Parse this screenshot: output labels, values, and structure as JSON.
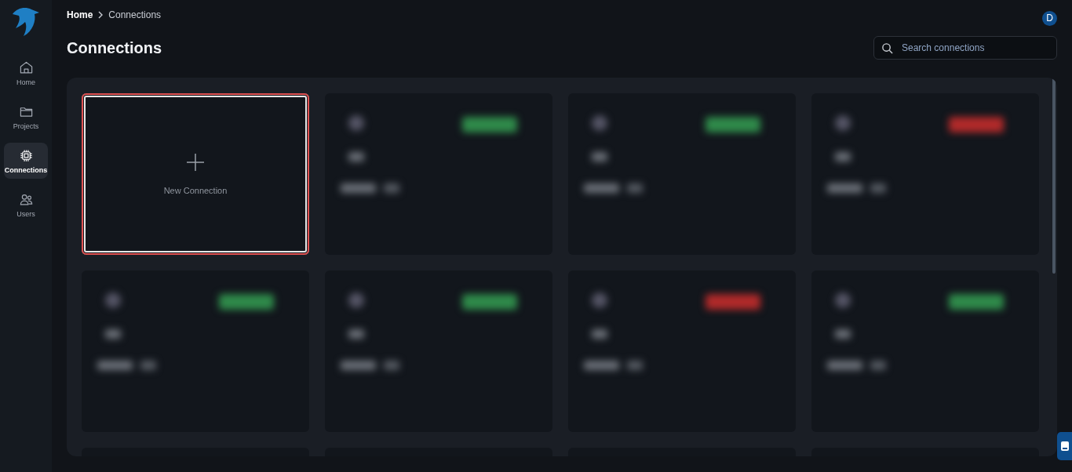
{
  "sidebar": {
    "items": [
      {
        "label": "Home",
        "selected": false
      },
      {
        "label": "Projects",
        "selected": false
      },
      {
        "label": "Connections",
        "selected": true
      },
      {
        "label": "Users",
        "selected": false
      }
    ]
  },
  "breadcrumb": [
    "Home",
    "Connections"
  ],
  "avatar": "D",
  "title": "Connections",
  "search": {
    "placeholder": "Search connections"
  },
  "cards": [
    {
      "kind": "new",
      "label": "New Connection",
      "highlighted": true
    },
    {
      "kind": "blurred",
      "color": "#2f8a4a"
    },
    {
      "kind": "blurred",
      "color": "#2f8a4a"
    },
    {
      "kind": "blurred",
      "color": "#b02a2a"
    },
    {
      "kind": "blurred",
      "color": "#2f8a4a"
    },
    {
      "kind": "blurred",
      "color": "#2f8a4a"
    },
    {
      "kind": "blurred",
      "color": "#b02a2a"
    },
    {
      "kind": "blurred",
      "color": "#2f8a4a"
    },
    {
      "kind": "empty"
    },
    {
      "kind": "empty"
    },
    {
      "kind": "empty"
    },
    {
      "kind": "empty"
    }
  ]
}
